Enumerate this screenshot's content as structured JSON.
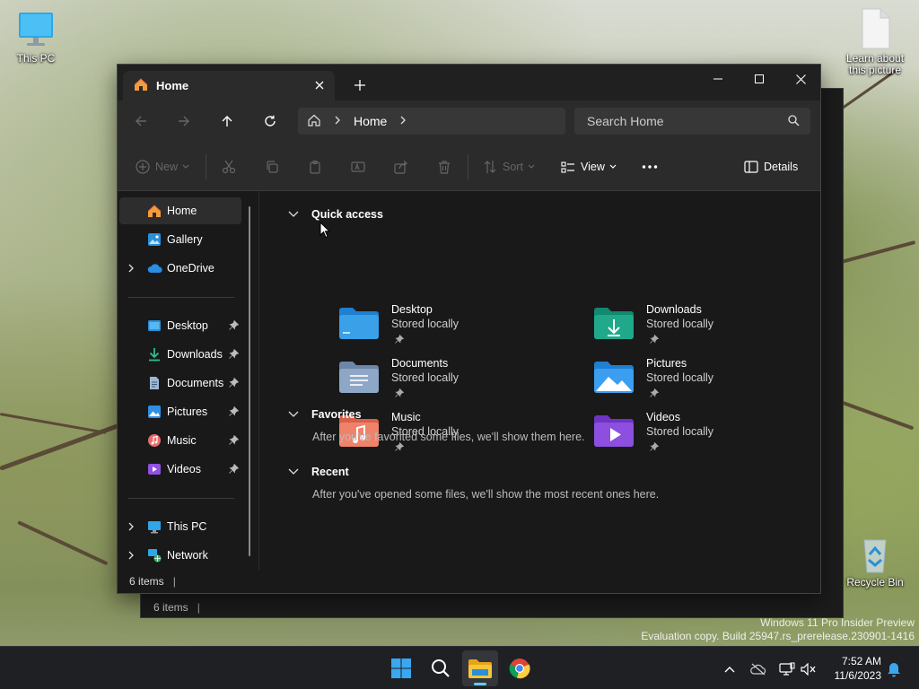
{
  "desktop": {
    "icons": [
      {
        "name": "This PC",
        "icon": "monitor-icon"
      },
      {
        "name": "Learn about this picture",
        "icon": "document-icon"
      },
      {
        "name": "Recycle Bin",
        "icon": "recycle-bin-icon"
      }
    ],
    "watermark": {
      "line1": "Windows 11 Pro Insider Preview",
      "line2": "Evaluation copy. Build 25947.rs_prerelease.230901-1416"
    }
  },
  "background_window": {
    "status_text": "6 items",
    "status_sep": "|"
  },
  "explorer": {
    "tab": {
      "label": "Home",
      "icon": "home-icon"
    },
    "new_tab_icon": "plus-icon",
    "window_controls": [
      "minimize-icon",
      "maximize-icon",
      "close-icon"
    ],
    "nav": {
      "back_icon": "arrow-left-icon",
      "forward_icon": "arrow-right-icon",
      "up_icon": "arrow-up-icon",
      "refresh_icon": "refresh-icon"
    },
    "address": {
      "breadcrumb": "Home"
    },
    "search": {
      "placeholder": "Search Home"
    },
    "toolbar": {
      "new_label": "New",
      "sort_label": "Sort",
      "view_label": "View",
      "more_label": "...",
      "details_label": "Details"
    },
    "sidebar": {
      "items": [
        {
          "label": "Home",
          "active": true
        },
        {
          "label": "Gallery"
        },
        {
          "label": "OneDrive",
          "expandable": true
        },
        {
          "label": "Desktop",
          "pinned": true
        },
        {
          "label": "Downloads",
          "pinned": true
        },
        {
          "label": "Documents",
          "pinned": true
        },
        {
          "label": "Pictures",
          "pinned": true
        },
        {
          "label": "Music",
          "pinned": true
        },
        {
          "label": "Videos",
          "pinned": true
        },
        {
          "label": "This PC",
          "expandable": true
        },
        {
          "label": "Network",
          "expandable": true
        }
      ]
    },
    "content": {
      "quick_access": {
        "title": "Quick access",
        "items": [
          {
            "name": "Desktop",
            "sub": "Stored locally",
            "color": "#3aa0e8"
          },
          {
            "name": "Downloads",
            "sub": "Stored locally",
            "color": "#1fa98a"
          },
          {
            "name": "Documents",
            "sub": "Stored locally",
            "color": "#8ea7c6"
          },
          {
            "name": "Pictures",
            "sub": "Stored locally",
            "color": "#3b9ef0"
          },
          {
            "name": "Music",
            "sub": "Stored locally",
            "color": "#f0826a"
          },
          {
            "name": "Videos",
            "sub": "Stored locally",
            "color": "#8c4fe0"
          }
        ]
      },
      "favorites": {
        "title": "Favorites",
        "empty": "After you've favorited some files, we'll show them here."
      },
      "recent": {
        "title": "Recent",
        "empty": "After you've opened some files, we'll show the most recent ones here."
      }
    },
    "status": {
      "count": "6 items",
      "sep": "|"
    }
  },
  "taskbar": {
    "apps": [
      "start-icon",
      "search-icon",
      "file-explorer-icon",
      "chrome-icon"
    ],
    "tray": [
      "chevron-up-icon",
      "onedrive-icon",
      "network-icon",
      "volume-muted-icon"
    ],
    "time": "7:52 AM",
    "date": "11/6/2023"
  },
  "colors": {
    "accent": "#60cdff",
    "window_bg": "#191919",
    "bar_bg": "#2b2b2b"
  }
}
